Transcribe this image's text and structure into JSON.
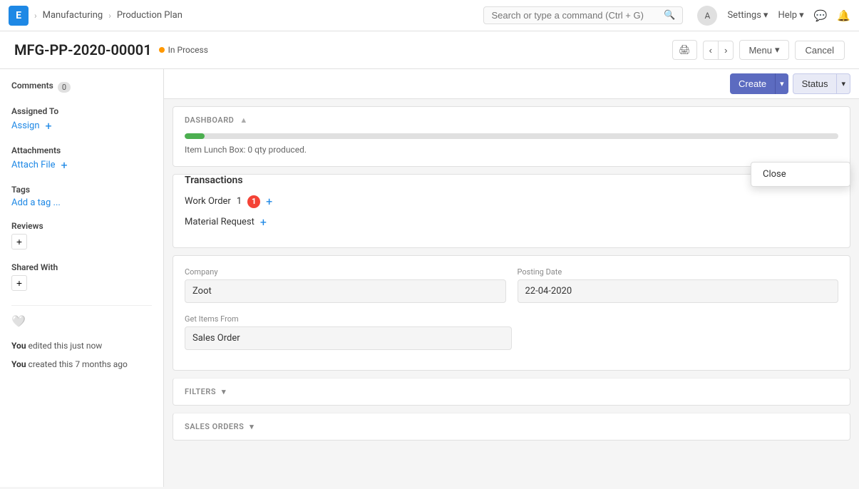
{
  "app": {
    "logo": "E",
    "breadcrumbs": [
      "Manufacturing",
      "Production Plan"
    ],
    "search_placeholder": "Search or type a command (Ctrl + G)"
  },
  "nav": {
    "settings_label": "Settings",
    "help_label": "Help",
    "avatar_label": "A"
  },
  "page": {
    "title": "MFG-PP-2020-00001",
    "status": "In Process",
    "menu_label": "Menu",
    "cancel_label": "Cancel"
  },
  "toolbar": {
    "create_label": "Create",
    "status_label": "Status"
  },
  "dropdown": {
    "items": [
      {
        "label": "Close"
      }
    ]
  },
  "sidebar": {
    "comments_label": "Comments",
    "comments_count": "0",
    "assigned_to_label": "Assigned To",
    "assign_label": "Assign",
    "attachments_label": "Attachments",
    "attach_file_label": "Attach File",
    "tags_label": "Tags",
    "add_tag_label": "Add a tag ...",
    "reviews_label": "Reviews",
    "shared_with_label": "Shared With",
    "activity_1": "You edited this just now",
    "activity_2": "You created this 7 months ago"
  },
  "dashboard": {
    "section_label": "DASHBOARD",
    "progress": 3,
    "info_text": "Item Lunch Box: 0 qty produced."
  },
  "transactions": {
    "title": "Transactions",
    "work_order_label": "Work Order",
    "work_order_count": "1",
    "work_order_badge": "1",
    "material_request_label": "Material Request"
  },
  "form": {
    "company_label": "Company",
    "company_value": "Zoot",
    "posting_date_label": "Posting Date",
    "posting_date_value": "22-04-2020",
    "get_items_from_label": "Get Items From",
    "get_items_from_value": "Sales Order"
  },
  "filters": {
    "section_label": "FILTERS"
  },
  "sales_orders": {
    "section_label": "SALES ORDERS"
  }
}
